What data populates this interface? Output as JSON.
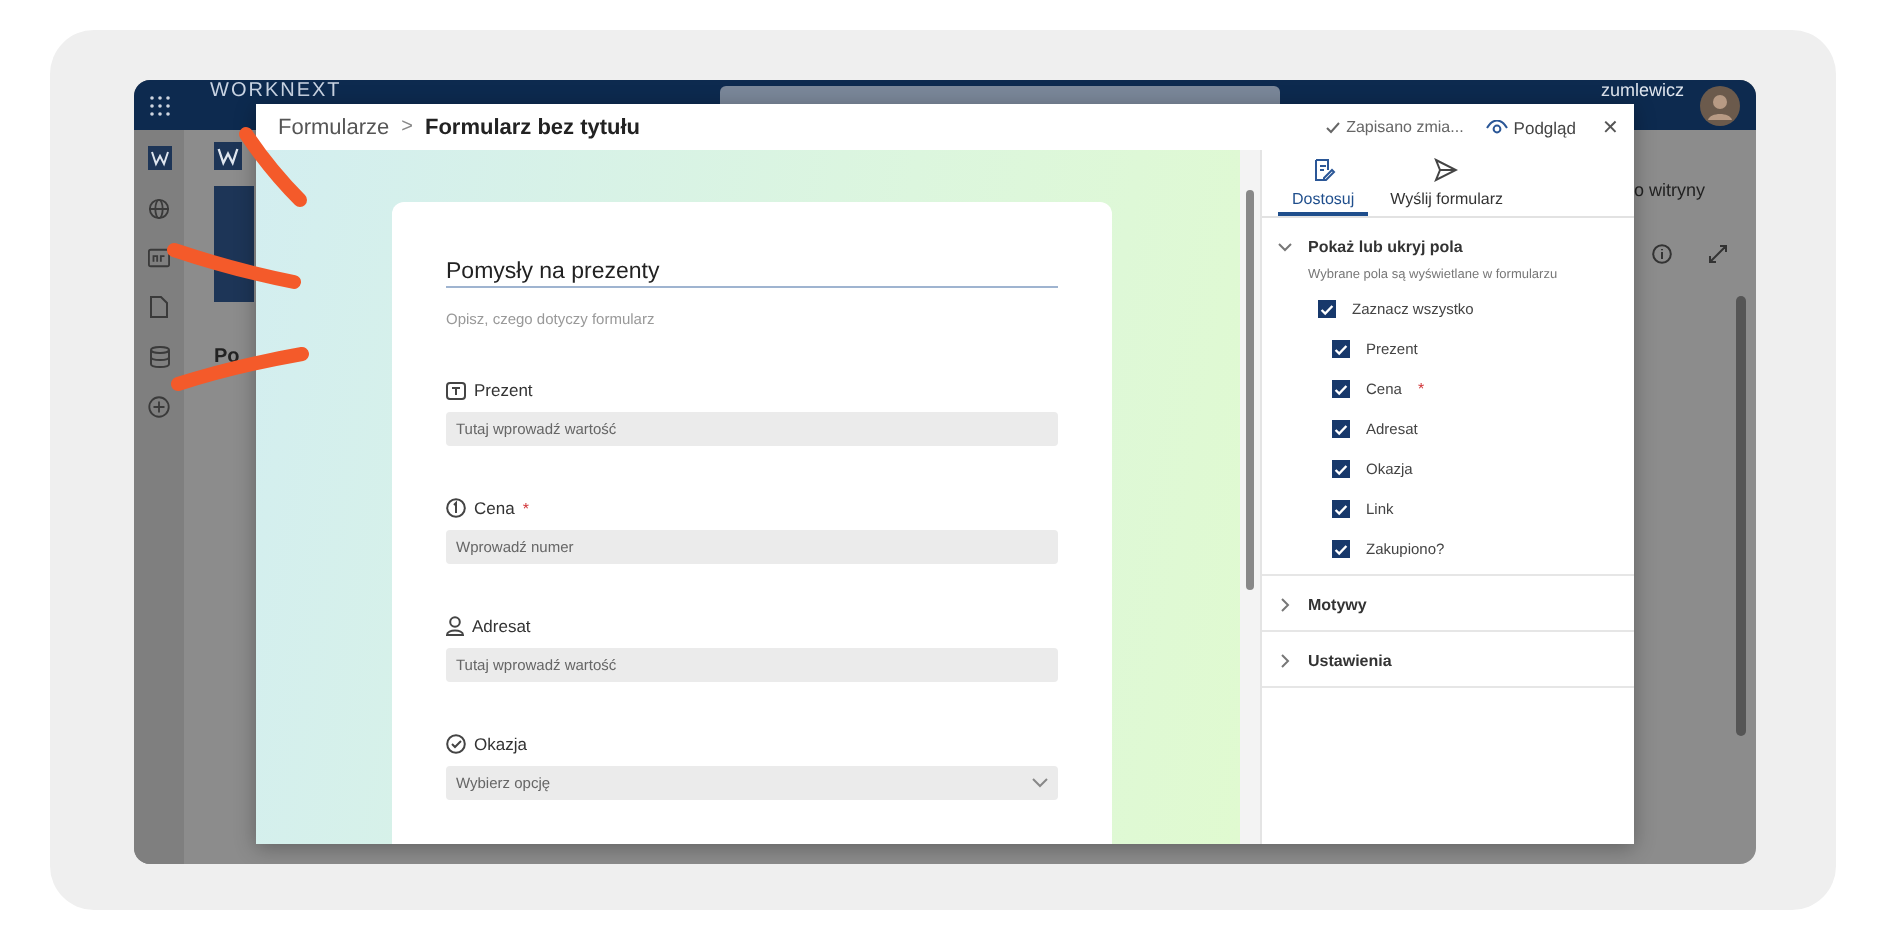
{
  "app": {
    "logo": "WORKNEXT",
    "user_name": "zumlewicz",
    "side_text": "o witryny",
    "content_text": "Po"
  },
  "dialog": {
    "breadcrumb": [
      "Formularze",
      "Formularz bez tytułu"
    ],
    "separator": ">",
    "save_status": "Zapisano zmia...",
    "preview_label": "Podgląd",
    "close": "✕"
  },
  "required_mark": "*",
  "form": {
    "title": "Pomysły na prezenty",
    "description_placeholder": "Opisz, czego dotyczy formularz",
    "questions": [
      {
        "kind": "text",
        "label": "Prezent",
        "required": false,
        "placeholder": "Tutaj wprowadź wartość"
      },
      {
        "kind": "number",
        "label": "Cena",
        "required": true,
        "placeholder": "Wprowadź numer"
      },
      {
        "kind": "person",
        "label": "Adresat",
        "required": false,
        "placeholder": "Tutaj wprowadź wartość"
      },
      {
        "kind": "choice",
        "label": "Okazja",
        "required": false,
        "placeholder": "Wybierz opcję"
      }
    ]
  },
  "panel": {
    "tabs": [
      {
        "label": "Dostosuj",
        "kind": "edit",
        "selected": true
      },
      {
        "label": "Wyślij formularz",
        "kind": "send",
        "selected": false
      }
    ],
    "sections": [
      {
        "title": "Pokaż lub ukryj pola",
        "expanded": true,
        "subtitle": "Wybrane pola są wyświetlane w formularzu",
        "select_all": {
          "label": "Zaznacz wszystko",
          "checked": true
        },
        "fields": [
          {
            "label": "Prezent",
            "required": false,
            "checked": true
          },
          {
            "label": "Cena",
            "required": true,
            "checked": true
          },
          {
            "label": "Adresat",
            "required": false,
            "checked": true
          },
          {
            "label": "Okazja",
            "required": false,
            "checked": true
          },
          {
            "label": "Link",
            "required": false,
            "checked": true
          },
          {
            "label": "Zakupiono?",
            "required": false,
            "checked": true
          }
        ]
      },
      {
        "title": "Motywy",
        "expanded": false
      },
      {
        "title": "Ustawienia",
        "expanded": false
      }
    ]
  }
}
